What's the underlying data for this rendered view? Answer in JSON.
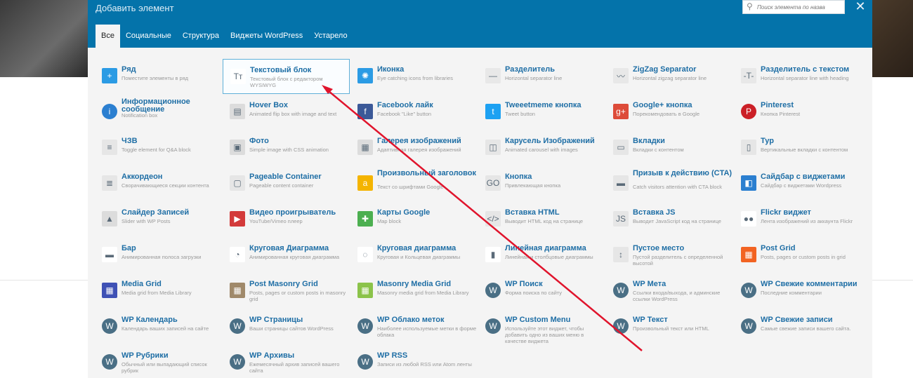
{
  "modal": {
    "title": "Добавить элемент",
    "search_placeholder": "Поиск элемента по назва",
    "tabs": [
      "Все",
      "Социальные",
      "Структура",
      "Виджеты WordPress",
      "Устарело"
    ],
    "active_tab": "Все"
  },
  "elements": [
    {
      "title": "Ряд",
      "desc": "Поместите элементы в ряд",
      "icon": "plus-icon",
      "color": "#2b9be4"
    },
    {
      "title": "Текстовый блок",
      "desc": "Текстовый блок с редактором WYSIWYG",
      "icon": "text-block-icon",
      "color": "#ffffff",
      "selected": true
    },
    {
      "title": "Иконка",
      "desc": "Eye catching icons from libraries",
      "icon": "sun-icon",
      "color": "#2b9be4"
    },
    {
      "title": "Разделитель",
      "desc": "Horizontal separator line",
      "icon": "separator-icon",
      "color": "#e8e8e8"
    },
    {
      "title": "ZigZag Separator",
      "desc": "Horizontal zigzag separator line",
      "icon": "zigzag-icon",
      "color": "#e8e8e8"
    },
    {
      "title": "Разделитель с текстом",
      "desc": "Horizontal separator line with heading",
      "icon": "text-separator-icon",
      "color": "#e8e8e8"
    },
    {
      "title": "Информационное сообщение",
      "desc": "Notification box",
      "icon": "info-icon",
      "color": "#2b7fd0"
    },
    {
      "title": "Hover Box",
      "desc": "Animated flip box with image and text",
      "icon": "hover-box-icon",
      "color": "#dcdcdc"
    },
    {
      "title": "Facebook лайк",
      "desc": "Facebook \"Like\" button",
      "icon": "facebook-icon",
      "color": "#3b5998"
    },
    {
      "title": "Tweeetmeme кнопка",
      "desc": "Tweet button",
      "icon": "twitter-icon",
      "color": "#1da1f2"
    },
    {
      "title": "Google+ кнопка",
      "desc": "Порекомендовать в Google",
      "icon": "google-plus-icon",
      "color": "#dd4b39"
    },
    {
      "title": "Pinterest",
      "desc": "Кнопка Pinterest",
      "icon": "pinterest-icon",
      "color": "#cb2027"
    },
    {
      "title": "ЧЗВ",
      "desc": "Toggle element for Q&A block",
      "icon": "faq-icon",
      "color": "#e6e6e6"
    },
    {
      "title": "Фото",
      "desc": "Simple image with CSS animation",
      "icon": "photo-icon",
      "color": "#dcdcdc"
    },
    {
      "title": "Галерея изображений",
      "desc": "Адаптивная галерея изображений",
      "icon": "gallery-icon",
      "color": "#dcdcdc"
    },
    {
      "title": "Карусель Изображений",
      "desc": "Animated carousel with images",
      "icon": "carousel-icon",
      "color": "#e6e6e6"
    },
    {
      "title": "Вкладки",
      "desc": "Вкладки с контентом",
      "icon": "tabs-icon",
      "color": "#e6e6e6"
    },
    {
      "title": "Тур",
      "desc": "Вертикальные вкладки с контентом",
      "icon": "tour-icon",
      "color": "#e6e6e6"
    },
    {
      "title": "Аккордеон",
      "desc": "Сворачивающиеся секции контента",
      "icon": "accordion-icon",
      "color": "#e6e6e6"
    },
    {
      "title": "Pageable Container",
      "desc": "Pageable content container",
      "icon": "pageable-icon",
      "color": "#e6e6e6"
    },
    {
      "title": "Произвольный заголовок",
      "desc": "Текст со шрифтами Google",
      "icon": "custom-heading-icon",
      "color": "#f4b400"
    },
    {
      "title": "Кнопка",
      "desc": "Привлекающая кнопка",
      "icon": "button-icon",
      "color": "#e6e6e6"
    },
    {
      "title": "Призыв к действию (CTA)",
      "desc": "Catch visitors attention with CTA block",
      "icon": "cta-icon",
      "color": "#e6e6e6"
    },
    {
      "title": "Сайдбар с виджетами",
      "desc": "Сайдбар с виджетами Wordpress",
      "icon": "sidebar-icon",
      "color": "#2b7fd0"
    },
    {
      "title": "Слайдер Записей",
      "desc": "Slider with WP Posts",
      "icon": "posts-slider-icon",
      "color": "#dcdcdc"
    },
    {
      "title": "Видео проигрыватель",
      "desc": "YouTube/Vimeo плеер",
      "icon": "video-icon",
      "color": "#d33a3a"
    },
    {
      "title": "Карты Google",
      "desc": "Map block",
      "icon": "map-icon",
      "color": "#4caf50"
    },
    {
      "title": "Вставка HTML",
      "desc": "Выводит HTML код на странице",
      "icon": "html-icon",
      "color": "#e6e6e6"
    },
    {
      "title": "Вставка JS",
      "desc": "Выводит JavaScript код на странице",
      "icon": "js-icon",
      "color": "#e6e6e6"
    },
    {
      "title": "Flickr виджет",
      "desc": "Лента изображений из аккаунта Flickr",
      "icon": "flickr-icon",
      "color": "#ffffff"
    },
    {
      "title": "Бар",
      "desc": "Анимированная полоса загрузки",
      "icon": "progress-bar-icon",
      "color": "#ffffff"
    },
    {
      "title": "Круговая Диаграмма",
      "desc": "Анимированная круговая диаграмма",
      "icon": "pie-chart-icon",
      "color": "#ffffff"
    },
    {
      "title": "Круговая диаграмма",
      "desc": "Круговая и Кольцевая диаграммы",
      "icon": "donut-chart-icon",
      "color": "#ffffff"
    },
    {
      "title": "Линейная диаграмма",
      "desc": "Линейная и столбцовые диаграммы",
      "icon": "bar-chart-icon",
      "color": "#ffffff"
    },
    {
      "title": "Пустое место",
      "desc": "Пустой разделитель с определенной высотой",
      "icon": "spacer-icon",
      "color": "#e6e6e6"
    },
    {
      "title": "Post Grid",
      "desc": "Posts, pages or custom posts in grid",
      "icon": "post-grid-icon",
      "color": "#f26322"
    },
    {
      "title": "Media Grid",
      "desc": "Media grid from Media Library",
      "icon": "media-grid-icon",
      "color": "#3f51b5"
    },
    {
      "title": "Post Masonry Grid",
      "desc": "Posts, pages or custom posts in masonry grid",
      "icon": "masonry-grid-icon",
      "color": "#a0896a"
    },
    {
      "title": "Masonry Media Grid",
      "desc": "Masonry media grid from Media Library",
      "icon": "masonry-media-icon",
      "color": "#8bc34a"
    },
    {
      "title": "WP Поиск",
      "desc": "Форма поиска по сайту",
      "icon": "wordpress-icon",
      "color": "#4a6f85"
    },
    {
      "title": "WP Мета",
      "desc": "Ссылки входа/выхода, и админские ссылки WordPress",
      "icon": "wordpress-icon",
      "color": "#4a6f85"
    },
    {
      "title": "WP Свежие комментарии",
      "desc": "Последние комментарии",
      "icon": "wordpress-icon",
      "color": "#4a6f85"
    },
    {
      "title": "WP Календарь",
      "desc": "Календарь ваших записей на сайте",
      "icon": "wordpress-icon",
      "color": "#4a6f85"
    },
    {
      "title": "WP Страницы",
      "desc": "Ваши страницы сайтов WordPress",
      "icon": "wordpress-icon",
      "color": "#4a6f85"
    },
    {
      "title": "WP Облако меток",
      "desc": "Наиболее используемые метки в форме облака",
      "icon": "wordpress-icon",
      "color": "#4a6f85"
    },
    {
      "title": "WP Custom Menu",
      "desc": "Используйте этот виджет, чтобы добавить одно из ваших меню в качестве виджета",
      "icon": "wordpress-icon",
      "color": "#4a6f85"
    },
    {
      "title": "WP Текст",
      "desc": "Произвольный текст или HTML",
      "icon": "wordpress-icon",
      "color": "#4a6f85"
    },
    {
      "title": "WP Свежие записи",
      "desc": "Самые свежие записи вашего сайта.",
      "icon": "wordpress-icon",
      "color": "#4a6f85"
    },
    {
      "title": "WP Рубрики",
      "desc": "Обычный или выпадающий список рубрик",
      "icon": "wordpress-icon",
      "color": "#4a6f85"
    },
    {
      "title": "WP Архивы",
      "desc": "Ежемесячный архив записей вашего сайта",
      "icon": "wordpress-icon",
      "color": "#4a6f85"
    },
    {
      "title": "WP RSS",
      "desc": "Записи из любой RSS или Atom ленты",
      "icon": "wordpress-icon",
      "color": "#4a6f85"
    }
  ]
}
